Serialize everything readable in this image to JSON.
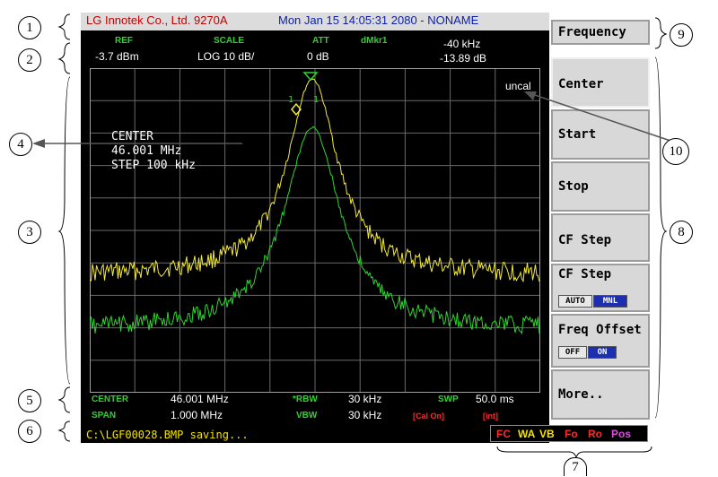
{
  "title_bar": {
    "company": "LG Innotek Co., Ltd. 9270A",
    "datetime": "Mon Jan 15 14:05:31 2080 - NONAME"
  },
  "header": {
    "ref_label": "REF",
    "ref_value": "-3.7 dBm",
    "scale_label": "SCALE",
    "scale_value": "LOG 10 dB/",
    "att_label": "ATT",
    "att_value": "0 dB",
    "dmkr_label": "dMkr1",
    "dmkr_freq": "-40 kHz",
    "dmkr_level": "-13.89 dB"
  },
  "plot": {
    "uncal": "uncal",
    "annotation_line1": "CENTER",
    "annotation_line2": "46.001 MHz",
    "annotation_line3": "STEP 100 kHz",
    "marker1": "1",
    "marker2": "1",
    "trace_colors": {
      "yellow": "#f2e93a",
      "green": "#2fd42f",
      "grid": "#6a6a6a"
    }
  },
  "footer": {
    "center_label": "CENTER",
    "center_value": "46.001 MHz",
    "span_label": "SPAN",
    "span_value": "1.000 MHz",
    "rbw_label": "*RBW",
    "rbw_value": "30 kHz",
    "vbw_label": "VBW",
    "vbw_value": "30 kHz",
    "swp_label": "SWP",
    "swp_value": "50.0 ms",
    "cal_on": "[Cal On]",
    "int": "[int]"
  },
  "message": "C:\\LGF00028.BMP saving...",
  "softkeys": {
    "frequency": "Frequency",
    "center": "Center",
    "start": "Start",
    "stop": "Stop",
    "cf_step": "CF Step",
    "cf_step2": "CF Step",
    "cf_auto": "AUTO",
    "cf_mnl": "MNL",
    "freq_offset": "Freq Offset",
    "off": "OFF",
    "on": "ON",
    "more": "More.."
  },
  "status": {
    "fc": "FC",
    "wa": "WA",
    "vb": "VB",
    "fo": "Fo",
    "ro": "Ro",
    "pos": "Pos"
  },
  "callouts": {
    "c1": "1",
    "c2": "2",
    "c3": "3",
    "c4": "4",
    "c5": "5",
    "c6": "6",
    "c7": "7",
    "c8": "8",
    "c9": "9",
    "c10": "10"
  }
}
